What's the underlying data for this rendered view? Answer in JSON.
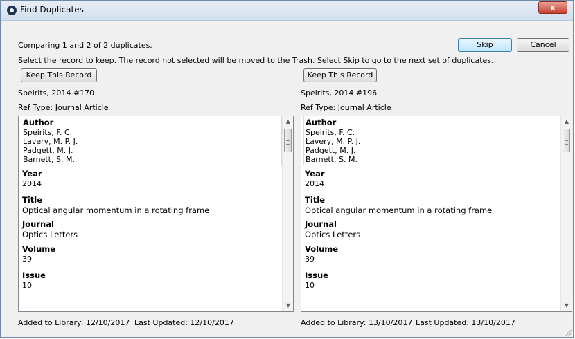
{
  "window": {
    "title": "Find Duplicates",
    "close_label": "x"
  },
  "header": {
    "comparing": "Comparing 1 and 2 of 2 duplicates.",
    "instructions": "Select the record to keep. The record not selected will be moved to the Trash. Select Skip to go to the next set of duplicates.",
    "skip_label": "Skip",
    "cancel_label": "Cancel"
  },
  "left": {
    "keep_label": "Keep This Record",
    "ref": "Speirits, 2014 #170",
    "ref_type": "Ref Type: Journal Article",
    "author_heading": "Author",
    "authors": [
      "Speirits, F. C.",
      "Lavery, M. P. J.",
      "Padgett, M. J.",
      "Barnett, S. M."
    ],
    "fields": [
      {
        "label": "Year",
        "value": "2014"
      },
      {
        "label": "Title",
        "value": "Optical angular momentum in a rotating frame"
      },
      {
        "label": "Journal",
        "value": "Optics Letters"
      },
      {
        "label": "Volume",
        "value": "39"
      },
      {
        "label": "Issue",
        "value": "10"
      }
    ],
    "added": "Added to Library: 12/10/2017",
    "updated": "Last Updated: 12/10/2017"
  },
  "right": {
    "keep_label": "Keep This Record",
    "ref": "Speirits, 2014 #196",
    "ref_type": "Ref Type: Journal Article",
    "author_heading": "Author",
    "authors": [
      "Speirits, F. C.",
      "Lavery, M. P. J.",
      "Padgett, M. J.",
      "Barnett, S. M."
    ],
    "fields": [
      {
        "label": "Year",
        "value": "2014"
      },
      {
        "label": "Title",
        "value": "Optical angular momentum in a rotating frame"
      },
      {
        "label": "Journal",
        "value": "Optics Letters"
      },
      {
        "label": "Volume",
        "value": "39"
      },
      {
        "label": "Issue",
        "value": "10"
      }
    ],
    "added": "Added to Library: 13/10/2017",
    "updated": "Last Updated: 13/10/2017"
  },
  "icons": {
    "app": "endnote-logo-icon",
    "scroll_up": "scroll-up-arrow-icon",
    "scroll_down": "scroll-down-arrow-icon"
  },
  "colors": {
    "title_bar": "#d2dfee",
    "close_button": "#c8402d",
    "default_button": "#bee6fd"
  }
}
